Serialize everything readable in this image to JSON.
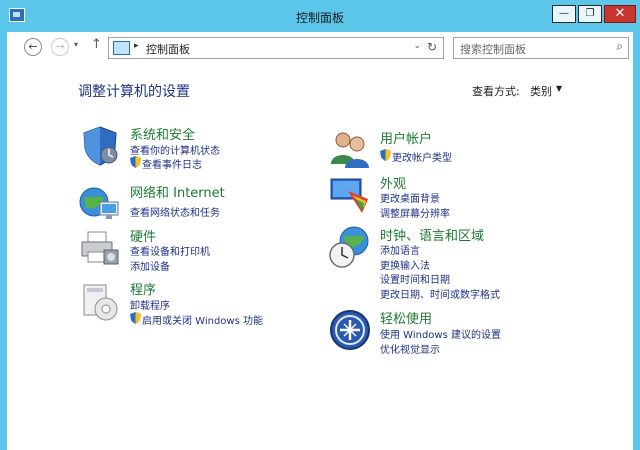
{
  "window": {
    "title": "控制面板",
    "close_glyph": "✕",
    "min_glyph": "—",
    "max_glyph": "❐"
  },
  "nav": {
    "back_glyph": "←",
    "forward_glyph": "→",
    "dropdown_glyph": "▾",
    "up_glyph": "↑"
  },
  "address": {
    "separator": "▸",
    "path": "控制面板",
    "dropdown_glyph": "⌄",
    "refresh_glyph": "↻"
  },
  "search": {
    "placeholder": "搜索控制面板",
    "icon_glyph": "⌕"
  },
  "page": {
    "heading": "调整计算机的设置",
    "view_by_label": "查看方式:",
    "view_by_value": "类别",
    "view_by_dropdown_glyph": "▼"
  },
  "categories_left": [
    {
      "title": "系统和安全",
      "links": [
        "查看你的计算机状态",
        "查看事件日志"
      ]
    },
    {
      "title": "网络和 Internet",
      "links": [
        "查看网络状态和任务"
      ]
    },
    {
      "title": "硬件",
      "links": [
        "查看设备和打印机",
        "添加设备"
      ]
    },
    {
      "title": "程序",
      "links": [
        "卸载程序",
        "启用或关闭 Windows 功能"
      ]
    }
  ],
  "categories_right": [
    {
      "title": "用户帐户",
      "links": [
        "更改帐户类型"
      ]
    },
    {
      "title": "外观",
      "links": [
        "更改桌面背景",
        "调整屏幕分辨率"
      ]
    },
    {
      "title": "时钟、语言和区域",
      "links": [
        "添加语言",
        "更换输入法",
        "设置时间和日期",
        "更改日期、时间或数字格式"
      ]
    },
    {
      "title": "轻松使用",
      "links": [
        "使用 Windows 建议的设置",
        "优化视觉显示"
      ]
    }
  ],
  "colors": {
    "titlebar": "#5bc6ea",
    "heading": "#1e3287",
    "category_title": "#1c7a33",
    "link": "#1e3287"
  }
}
